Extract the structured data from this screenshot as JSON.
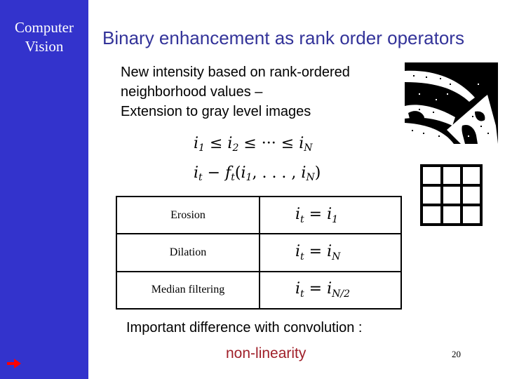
{
  "sidebar": {
    "title_line1": "Computer",
    "title_line2": "Vision",
    "background_color": "#3333CC",
    "nav_icon": "right-arrow-icon",
    "nav_icon_color": "#FF0000"
  },
  "slide": {
    "title": "Binary enhancement as rank order operators",
    "title_color": "#333399",
    "body_lines": [
      "New intensity based on rank-ordered",
      "neighborhood values –",
      "Extension to gray level images"
    ],
    "formula1": {
      "parts": [
        "i",
        "1",
        " ≤ ",
        "i",
        "2",
        " ≤ ··· ≤ ",
        "i",
        "N"
      ]
    },
    "formula2": {
      "lhs": "i",
      "lhs_sub": "t",
      "op": " − ",
      "fn": "f",
      "fn_sub": "t",
      "args_open": "(",
      "arg1": "i",
      "arg1_sub": "1",
      "mid": ", . . . , ",
      "arg2": "i",
      "arg2_sub": "N",
      "args_close": ")"
    },
    "table": {
      "rows": [
        {
          "name": "Erosion",
          "lhs": "i",
          "lhs_sub": "t",
          "op": " = ",
          "rhs": "i",
          "rhs_sub": "1"
        },
        {
          "name": "Dilation",
          "lhs": "i",
          "lhs_sub": "t",
          "op": " = ",
          "rhs": "i",
          "rhs_sub": "N"
        },
        {
          "name": "Median filtering",
          "lhs": "i",
          "lhs_sub": "t",
          "op": " = ",
          "rhs": "i",
          "rhs_sub": "N/2"
        }
      ]
    },
    "important_text": "Important difference with convolution :",
    "highlight_text": "non-linearity",
    "highlight_color": "#A0202A",
    "page_number": "20",
    "images": {
      "binary_image": "noisy-binary-image",
      "neighborhood_grid": "3x3-neighborhood-grid"
    }
  }
}
